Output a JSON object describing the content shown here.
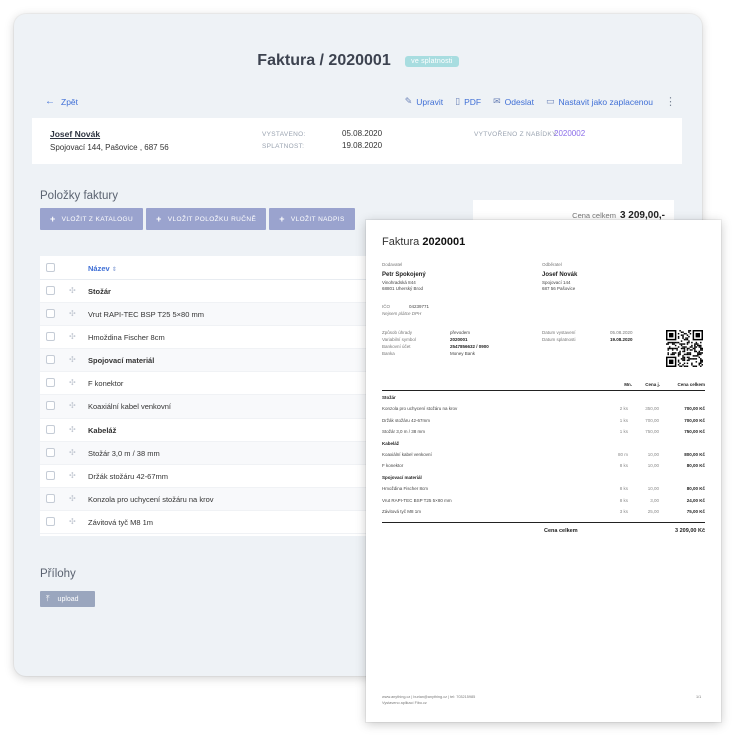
{
  "header": {
    "title": "Faktura / 2020001",
    "status": "ve splatnosti"
  },
  "toolbar": {
    "back": "Zpět",
    "actions": [
      "Upravit",
      "PDF",
      "Odeslat",
      "Nastavit jako zaplacenou"
    ]
  },
  "customer": {
    "name": "Josef Novák",
    "address": "Spojovací 144, Pašovice , 687 56",
    "issued_label": "VYSTAVENO:",
    "issued": "05.08.2020",
    "due_label": "SPLATNOST:",
    "due": "19.08.2020",
    "from_offer_label": "VYTVOŘENO Z NABÍDKY:",
    "from_offer": "2020002"
  },
  "items_section": {
    "title": "Položky faktury",
    "buttons": [
      "VLOŽIT Z KATALOGU",
      "VLOŽIT POLOŽKU RUČNĚ",
      "VLOŽIT NADPIS"
    ],
    "total_label": "Cena celkem",
    "total_value": "3 209,00,-",
    "column_name": "Název",
    "rows": [
      {
        "label": "Stožár",
        "bold": true
      },
      {
        "label": "Vrut RAPI-TEC BSP T25 5×80 mm",
        "bold": false
      },
      {
        "label": "Hmoždina Fischer 8cm",
        "bold": false
      },
      {
        "label": "Spojovací materiál",
        "bold": true
      },
      {
        "label": "F konektor",
        "bold": false
      },
      {
        "label": "Koaxiální kabel venkovní",
        "bold": false
      },
      {
        "label": "Kabeláž",
        "bold": true
      },
      {
        "label": "Stožár 3,0 m / 38 mm",
        "bold": false
      },
      {
        "label": "Držák stožáru 42-67mm",
        "bold": false
      },
      {
        "label": "Konzola pro uchycení stožáru na krov",
        "bold": false
      },
      {
        "label": "Závitová tyč M8 1m",
        "bold": false
      }
    ]
  },
  "attachments": {
    "title": "Přílohy",
    "upload": "upload"
  },
  "pdf": {
    "title_prefix": "Faktura",
    "title_number": "2020001",
    "supplier_label": "Dodavatel",
    "supplier_name": "Petr Spokojený",
    "supplier_addr1": "Vinohradská 844",
    "supplier_addr2": "68801 Uherský Brod",
    "customer_label": "Odběratel",
    "customer_name": "Josef Novák",
    "customer_addr1": "Spojovací 144",
    "customer_addr2": "687 56 Pašovice",
    "ico_label": "IČO",
    "ico": "04239771",
    "vat_note": "Nejsem plátce DPH",
    "pay_method_label": "Způsob úhrady",
    "pay_method": "převodem",
    "var_symbol_label": "Variabilní symbol",
    "var_symbol": "2020001",
    "account_label": "Bankovní účet",
    "account": "2547856632 / 0900",
    "bank_label": "Banka",
    "bank": "Money Bank",
    "issue_label": "Datum vystavení",
    "issue": "05.08.2020",
    "due_label": "Datum splatnosti",
    "due": "19.08.2020",
    "col_qty": "Mn.",
    "col_unit": "Cena j.",
    "col_total": "Cena celkem",
    "lines": [
      {
        "name": "Stožár",
        "group": true
      },
      {
        "name": "Konzola pro uchycení stožáru na krov",
        "qty": "2 ks",
        "unit": "350,00",
        "total": "700,00 Kč"
      },
      {
        "name": "Držák stožáru 42-67mm",
        "qty": "1 ks",
        "unit": "700,00",
        "total": "700,00 Kč"
      },
      {
        "name": "Stožár 3,0 m / 38 mm",
        "qty": "1 ks",
        "unit": "750,00",
        "total": "750,00 Kč"
      },
      {
        "name": "Kabeláž",
        "group": true
      },
      {
        "name": "Koaxiální kabel venkovní",
        "qty": "80 m",
        "unit": "10,00",
        "total": "800,00 Kč"
      },
      {
        "name": "F konektor",
        "qty": "8 ks",
        "unit": "10,00",
        "total": "80,00 Kč"
      },
      {
        "name": "Spojovací materiál",
        "group": true
      },
      {
        "name": "Hmoždina Fischer 8cm",
        "qty": "8 ks",
        "unit": "10,00",
        "total": "80,00 Kč"
      },
      {
        "name": "Vrut RAPI-TEC BSP T25 5×80 mm",
        "qty": "8 ks",
        "unit": "3,00",
        "total": "24,00 Kč"
      },
      {
        "name": "Závitová tyč M8 1m",
        "qty": "3 ks",
        "unit": "25,00",
        "total": "75,00 Kč"
      }
    ],
    "total_label": "Cena celkem",
    "total": "3 209,00 Kč",
    "footer_line1": "www.anything.cz | burian@anything.cz | tel: 703215985",
    "footer_line2": "Vystaveno aplikací Fibo.cz",
    "page": "1/1"
  }
}
